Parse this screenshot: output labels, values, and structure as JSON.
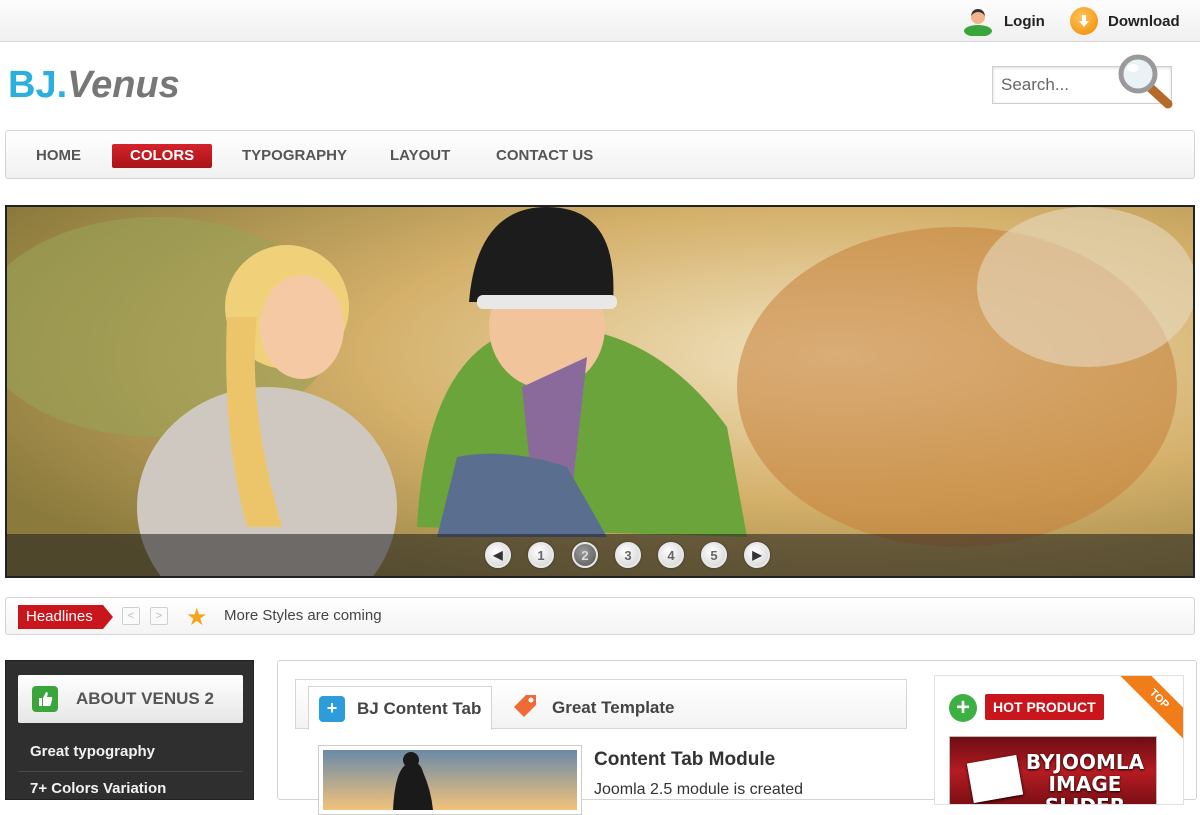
{
  "topbar": {
    "login_label": "Login",
    "download_label": "Download"
  },
  "header": {
    "logo_part1": "BJ.",
    "logo_part2": "Venus",
    "search_placeholder": "Search..."
  },
  "nav": {
    "items": [
      {
        "label": "HOME",
        "active": false
      },
      {
        "label": "COLORS",
        "active": true
      },
      {
        "label": "TYPOGRAPHY",
        "active": false
      },
      {
        "label": "LAYOUT",
        "active": false
      },
      {
        "label": "CONTACT US",
        "active": false
      }
    ]
  },
  "slider": {
    "pages": [
      "1",
      "2",
      "3",
      "4",
      "5"
    ],
    "active_page": "2"
  },
  "headlines": {
    "label": "Headlines",
    "text": "More Styles are coming"
  },
  "sidebar": {
    "title": "ABOUT VENUS 2",
    "items": [
      "Great typography",
      "7+ Colors Variation"
    ]
  },
  "content_tabs": {
    "tabs": [
      {
        "label": "BJ Content Tab",
        "icon": "plus-square-icon",
        "active": true
      },
      {
        "label": "Great Template",
        "icon": "tag-icon",
        "active": false
      }
    ],
    "article_title": "Content Tab Module",
    "article_text": "Joomla 2.5 module is created"
  },
  "hot_product": {
    "label": "HOT PRODUCT",
    "ribbon": "TOP",
    "image_text": "BYJOOMLA IMAGE SLIDER"
  },
  "colors": {
    "accent_red": "#c9161d",
    "logo_blue": "#2bb0de",
    "green": "#3cb043",
    "orange": "#f07d1a"
  }
}
